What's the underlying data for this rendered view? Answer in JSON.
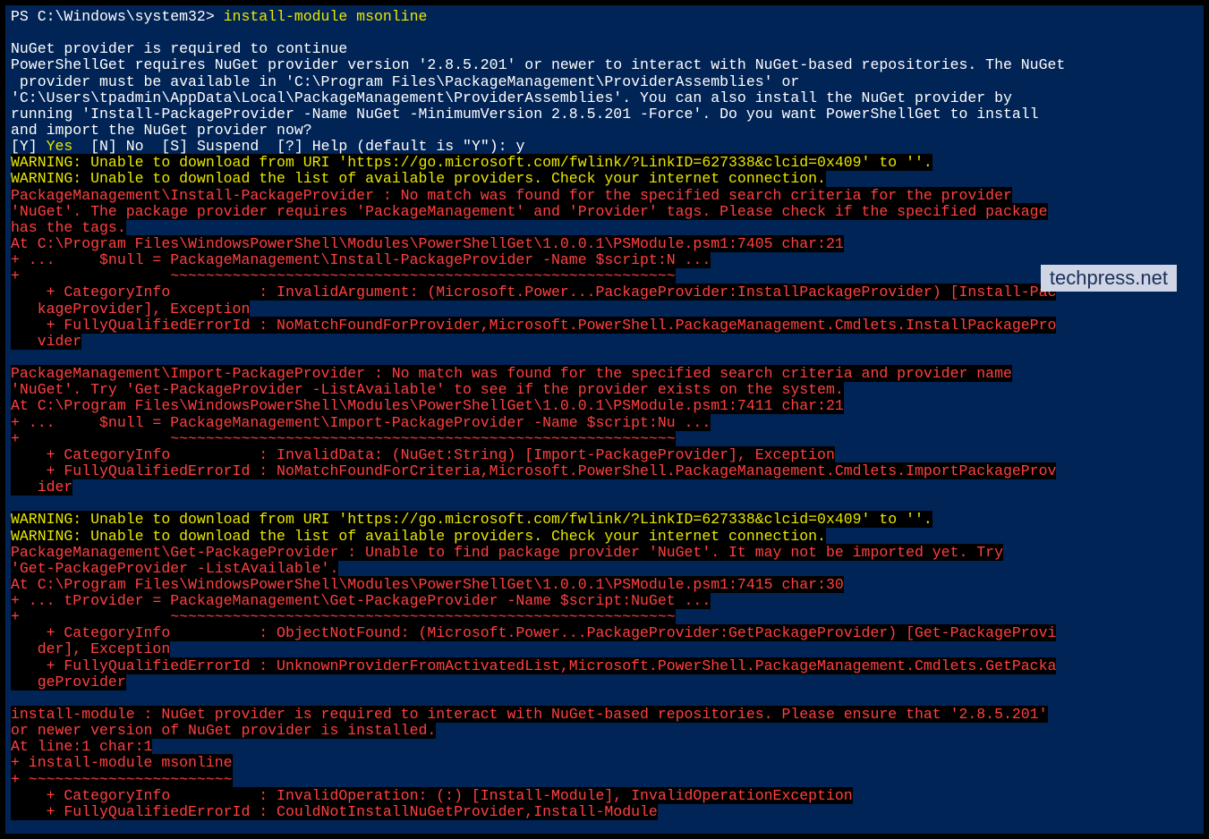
{
  "prompt": {
    "prefix": "PS C:\\Windows\\system32> ",
    "command": "install-module msonline"
  },
  "nuget_header": "NuGet provider is required to continue",
  "nuget_body1": "PowerShellGet requires NuGet provider version '2.8.5.201' or newer to interact with NuGet-based repositories. The NuGet",
  "nuget_body2": " provider must be available in 'C:\\Program Files\\PackageManagement\\ProviderAssemblies' or",
  "nuget_body3": "'C:\\Users\\tpadmin\\AppData\\Local\\PackageManagement\\ProviderAssemblies'. You can also install the NuGet provider by",
  "nuget_body4": "running 'Install-PackageProvider -Name NuGet -MinimumVersion 2.8.5.201 -Force'. Do you want PowerShellGet to install",
  "nuget_body5": "and import the NuGet provider now?",
  "options": {
    "y_bracket": "[Y] ",
    "y_label": "Yes",
    "n_bracket": "  [N] ",
    "n_label": "No",
    "s_bracket": "  [S] ",
    "s_label": "Suspend",
    "q_bracket": "  [?] ",
    "q_label": "Help (default is \"Y\"): ",
    "response": "y"
  },
  "warn1": "WARNING: Unable to download from URI 'https://go.microsoft.com/fwlink/?LinkID=627338&clcid=0x409' to ''.",
  "warn2": "WARNING: Unable to download the list of available providers. Check your internet connection.",
  "err1_l1": "PackageManagement\\Install-PackageProvider : No match was found for the specified search criteria for the provider",
  "err1_l2": "'NuGet'. The package provider requires 'PackageManagement' and 'Provider' tags. Please check if the specified package",
  "err1_l3": "has the tags.",
  "err1_l4": "At C:\\Program Files\\WindowsPowerShell\\Modules\\PowerShellGet\\1.0.0.1\\PSModule.psm1:7405 char:21",
  "err1_l5": "+ ...     $null = PackageManagement\\Install-PackageProvider -Name $script:N ...",
  "err1_l6": "+                 ~~~~~~~~~~~~~~~~~~~~~~~~~~~~~~~~~~~~~~~~~~~~~~~~~~~~~~~~~",
  "err1_l7": "    + CategoryInfo          : InvalidArgument: (Microsoft.Power...PackageProvider:InstallPackageProvider) [Install-Pac",
  "err1_l8": "   kageProvider], Exception",
  "err1_l9": "    + FullyQualifiedErrorId : NoMatchFoundForProvider,Microsoft.PowerShell.PackageManagement.Cmdlets.InstallPackagePro",
  "err1_l10": "   vider",
  "err2_l1": "PackageManagement\\Import-PackageProvider : No match was found for the specified search criteria and provider name",
  "err2_l2": "'NuGet'. Try 'Get-PackageProvider -ListAvailable' to see if the provider exists on the system.",
  "err2_l3": "At C:\\Program Files\\WindowsPowerShell\\Modules\\PowerShellGet\\1.0.0.1\\PSModule.psm1:7411 char:21",
  "err2_l4": "+ ...     $null = PackageManagement\\Import-PackageProvider -Name $script:Nu ...",
  "err2_l5": "+                 ~~~~~~~~~~~~~~~~~~~~~~~~~~~~~~~~~~~~~~~~~~~~~~~~~~~~~~~~~",
  "err2_l6": "    + CategoryInfo          : InvalidData: (NuGet:String) [Import-PackageProvider], Exception",
  "err2_l7": "    + FullyQualifiedErrorId : NoMatchFoundForCriteria,Microsoft.PowerShell.PackageManagement.Cmdlets.ImportPackageProv",
  "err2_l8": "   ider",
  "warn3": "WARNING: Unable to download from URI 'https://go.microsoft.com/fwlink/?LinkID=627338&clcid=0x409' to ''.",
  "warn4": "WARNING: Unable to download the list of available providers. Check your internet connection.",
  "err3_l1": "PackageManagement\\Get-PackageProvider : Unable to find package provider 'NuGet'. It may not be imported yet. Try",
  "err3_l2": "'Get-PackageProvider -ListAvailable'.",
  "err3_l3": "At C:\\Program Files\\WindowsPowerShell\\Modules\\PowerShellGet\\1.0.0.1\\PSModule.psm1:7415 char:30",
  "err3_l4": "+ ... tProvider = PackageManagement\\Get-PackageProvider -Name $script:NuGet ...",
  "err3_l5": "+                 ~~~~~~~~~~~~~~~~~~~~~~~~~~~~~~~~~~~~~~~~~~~~~~~~~~~~~~~~~",
  "err3_l6": "    + CategoryInfo          : ObjectNotFound: (Microsoft.Power...PackageProvider:GetPackageProvider) [Get-PackageProvi",
  "err3_l7": "   der], Exception",
  "err3_l8": "    + FullyQualifiedErrorId : UnknownProviderFromActivatedList,Microsoft.PowerShell.PackageManagement.Cmdlets.GetPacka",
  "err3_l9": "   geProvider",
  "err4_l1": "install-module : NuGet provider is required to interact with NuGet-based repositories. Please ensure that '2.8.5.201'",
  "err4_l2": "or newer version of NuGet provider is installed.",
  "err4_l3": "At line:1 char:1",
  "err4_l4": "+ install-module msonline",
  "err4_l5": "+ ~~~~~~~~~~~~~~~~~~~~~~~",
  "err4_l6": "    + CategoryInfo          : InvalidOperation: (:) [Install-Module], InvalidOperationException",
  "err4_l7": "    + FullyQualifiedErrorId : CouldNotInstallNuGetProvider,Install-Module",
  "watermark": "techpress.net"
}
